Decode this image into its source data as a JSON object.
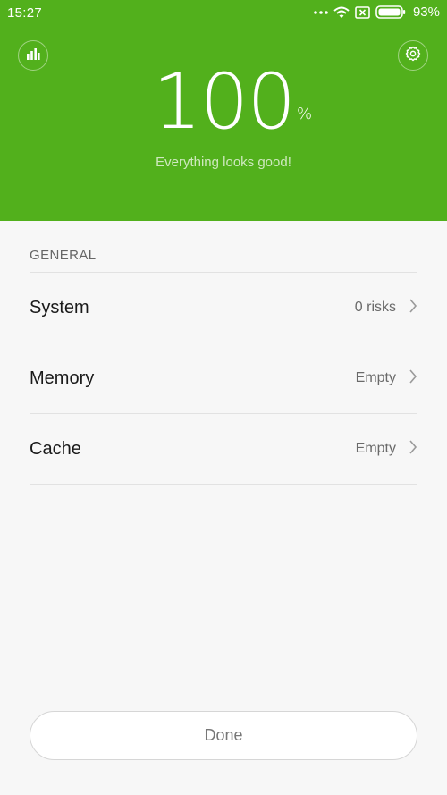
{
  "status_bar": {
    "time": "15:27",
    "battery_percent": "93%",
    "icons": [
      "more-dots-icon",
      "wifi-icon",
      "no-sim-icon",
      "battery-icon"
    ]
  },
  "header": {
    "score": "100",
    "score_unit": "%",
    "message": "Everything looks good!",
    "left_icon": "bar-chart-icon",
    "right_icon": "gear-icon",
    "accent_color": "#52b01c"
  },
  "section": {
    "title": "GENERAL"
  },
  "items": [
    {
      "label": "System",
      "value": "0 risks"
    },
    {
      "label": "Memory",
      "value": "Empty"
    },
    {
      "label": "Cache",
      "value": "Empty"
    }
  ],
  "footer": {
    "done_label": "Done"
  }
}
